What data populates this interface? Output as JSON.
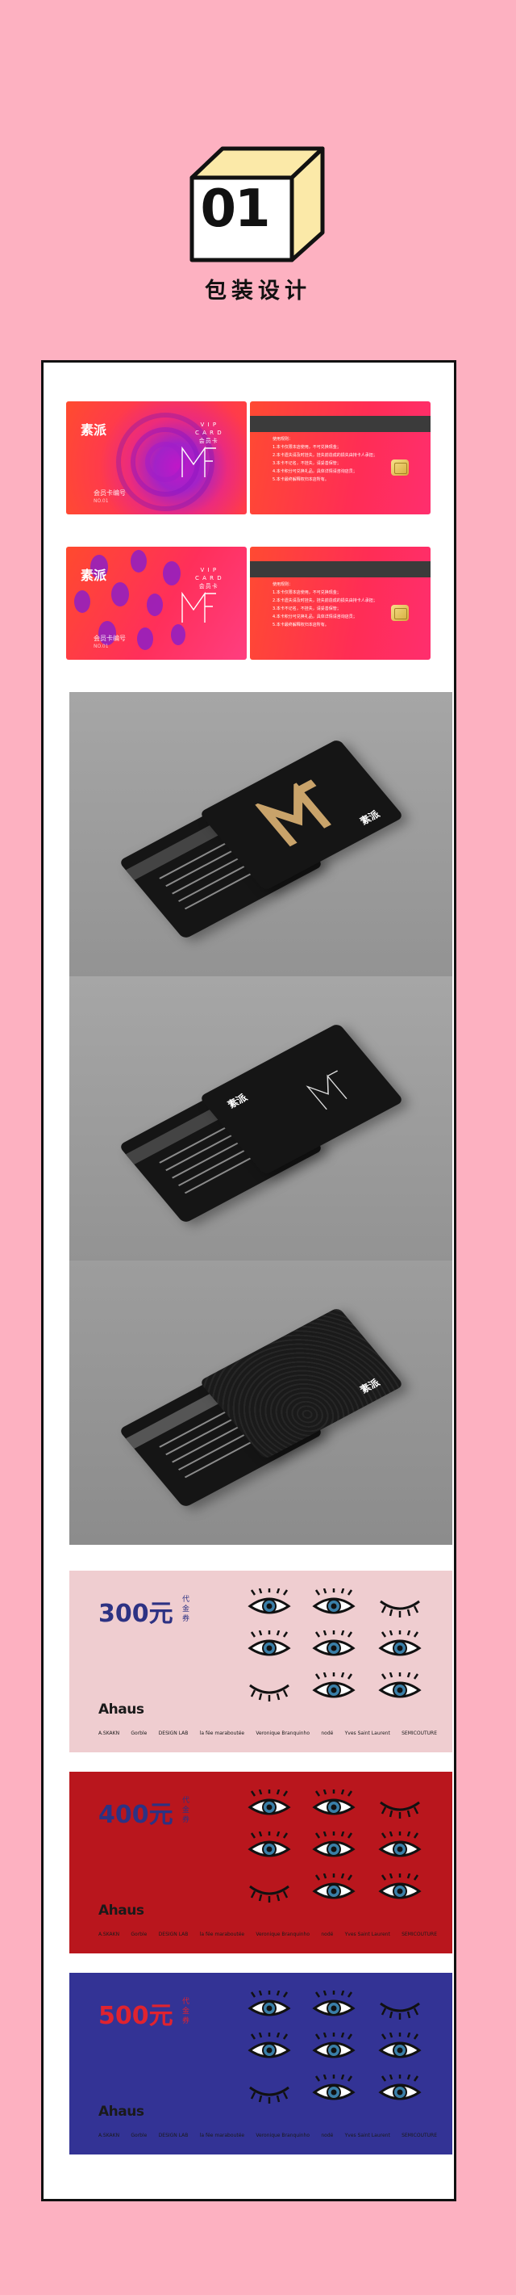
{
  "header": {
    "number": "01",
    "title": "包装设计"
  },
  "cards": {
    "front1": {
      "brand": "素派",
      "name": "会员卡编号",
      "no": "NO.01",
      "vip": [
        "V I P",
        "C A R D",
        "会员卡"
      ]
    },
    "front2": {
      "brand": "素派",
      "name": "会员卡编号",
      "no": "NO.01",
      "vip": [
        "V I P",
        "C A R D",
        "会员卡"
      ]
    },
    "back_rules": [
      "使用规则：",
      "1.本卡仅限本店使用，不可兑换现金；",
      "2.本卡遗失请及时挂失，挂失前造成的损失由持卡人承担；",
      "3.本卡不记名，不挂失，请妥善保管；",
      "4.本卡积分可兑换礼品，具体详情请咨询店员；",
      "5.本卡最终解释权归本店所有。"
    ]
  },
  "mockups": {
    "brand": "素派"
  },
  "vouchers": [
    {
      "amount": "300元",
      "sub": "代金券",
      "bg": "#efcdd0",
      "fg": "#2d3283",
      "lid": "#1a1a1a",
      "logo": "Ahaus"
    },
    {
      "amount": "400元",
      "sub": "代金券",
      "bg": "#b9161d",
      "fg": "#2d3283",
      "lid": "#1a1a1a",
      "logo": "Ahaus"
    },
    {
      "amount": "500元",
      "sub": "代金券",
      "bg": "#333395",
      "fg": "#e0232f",
      "lid": "#1a1a1a",
      "logo": "Ahaus"
    }
  ],
  "voucher_brands": [
    "A.SKAKN",
    "Gorble",
    "DESIGN LAB",
    "la fée maraboutée",
    "Veronique Branquinho",
    "nodé",
    "Yves Saint Laurent",
    "SEMICOUTURE"
  ]
}
